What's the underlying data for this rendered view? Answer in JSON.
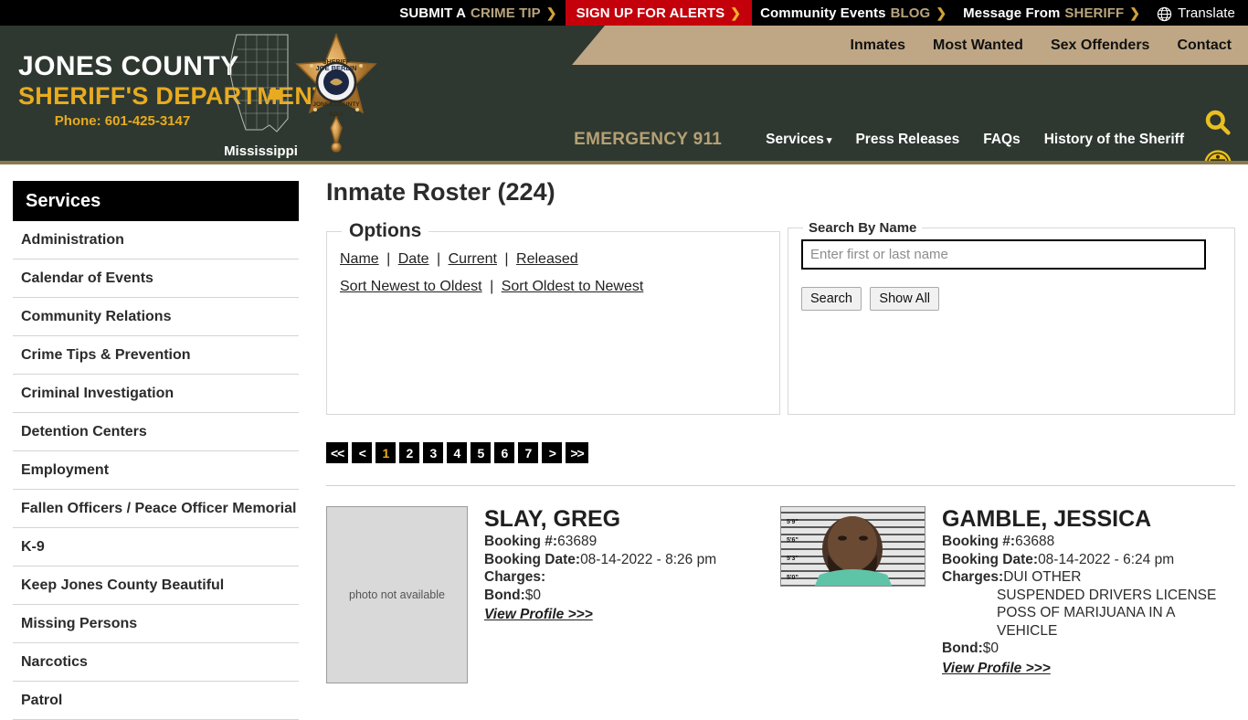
{
  "topbar": {
    "items": [
      {
        "text": "SUBMIT A",
        "accent": "CRIME TIP",
        "chevron": "❯",
        "highlight": false
      },
      {
        "text": "SIGN UP FOR ALERTS",
        "accent": "",
        "chevron": "❯",
        "highlight": true
      },
      {
        "text": "Community Events",
        "accent": "BLOG",
        "chevron": "❯",
        "highlight": false
      },
      {
        "text": "Message From",
        "accent": "SHERIFF",
        "chevron": "❯",
        "highlight": false
      }
    ],
    "translate_label": "Translate",
    "globe_icon": "globe-icon"
  },
  "header": {
    "brand_line1": "JONES COUNTY",
    "brand_line2": "SHERIFF'S DEPARTMENT",
    "phone_label": "Phone:",
    "phone_number": "601-425-3147",
    "state_label": "Mississippi",
    "badge_alt": "sheriff-star-badge",
    "secondary_nav": [
      "Inmates",
      "Most Wanted",
      "Sex Offenders",
      "Contact"
    ],
    "emergency_label": "EMERGENCY",
    "emergency_number": "911",
    "main_nav": [
      {
        "label": "Services",
        "has_caret": true
      },
      {
        "label": "Press Releases",
        "has_caret": false
      },
      {
        "label": "FAQs",
        "has_caret": false
      },
      {
        "label": "History of the Sheriff",
        "has_caret": false
      }
    ],
    "search_icon": "search-icon",
    "accessibility_icon": "accessibility-icon",
    "colors": {
      "header_bg": "#2e3830",
      "tan_band": "#bfa786",
      "gold": "#e8ab1f",
      "alert_red": "#c4000b",
      "border_olive": "#8a7a52"
    }
  },
  "sidebar": {
    "heading": "Services",
    "items": [
      "Administration",
      "Calendar of Events",
      "Community Relations",
      "Crime Tips & Prevention",
      "Criminal Investigation",
      "Detention Centers",
      "Employment",
      "Fallen Officers / Peace Officer Memorial",
      "K-9",
      "Keep Jones County Beautiful",
      "Missing Persons",
      "Narcotics",
      "Patrol"
    ]
  },
  "main": {
    "page_title": "Inmate Roster (224)",
    "options_panel": {
      "legend": "Options",
      "filter_links": [
        "Name",
        "Date",
        "Current",
        "Released"
      ],
      "sort_links": [
        "Sort Newest to Oldest",
        "Sort Oldest to Newest"
      ],
      "separator": "|"
    },
    "search_panel": {
      "legend": "Search By Name",
      "input_value": "",
      "input_placeholder": "Enter first or last name",
      "search_button": "Search",
      "show_all_button": "Show All"
    },
    "pagination": {
      "first": "<<",
      "prev": "<",
      "pages": [
        "1",
        "2",
        "3",
        "4",
        "5",
        "6",
        "7"
      ],
      "current": "1",
      "next": ">",
      "last": ">>"
    },
    "records": [
      {
        "name": "SLAY, GREG",
        "photo": "photo not available",
        "has_photo": false,
        "booking_label": "Booking #:",
        "booking_number": "63689",
        "date_label": "Booking Date:",
        "booking_date": "08-14-2022 - 8:26 pm",
        "charges_label": "Charges:",
        "charges": [],
        "bond_label": "Bond:",
        "bond": "$0",
        "profile_link": "View Profile >>>"
      },
      {
        "name": "GAMBLE, JESSICA",
        "photo": "mugshot",
        "has_photo": true,
        "booking_label": "Booking #:",
        "booking_number": "63688",
        "date_label": "Booking Date:",
        "booking_date": "08-14-2022 - 6:24 pm",
        "charges_label": "Charges:",
        "charges": [
          "DUI OTHER",
          "SUSPENDED DRIVERS LICENSE",
          "POSS OF MARIJUANA IN A",
          "VEHICLE"
        ],
        "bond_label": "Bond:",
        "bond": "$0",
        "profile_link": "View Profile >>>",
        "mugshot_marks": [
          "5'9\"",
          "5'6\"",
          "5'3\"",
          "5'0\""
        ]
      }
    ]
  }
}
